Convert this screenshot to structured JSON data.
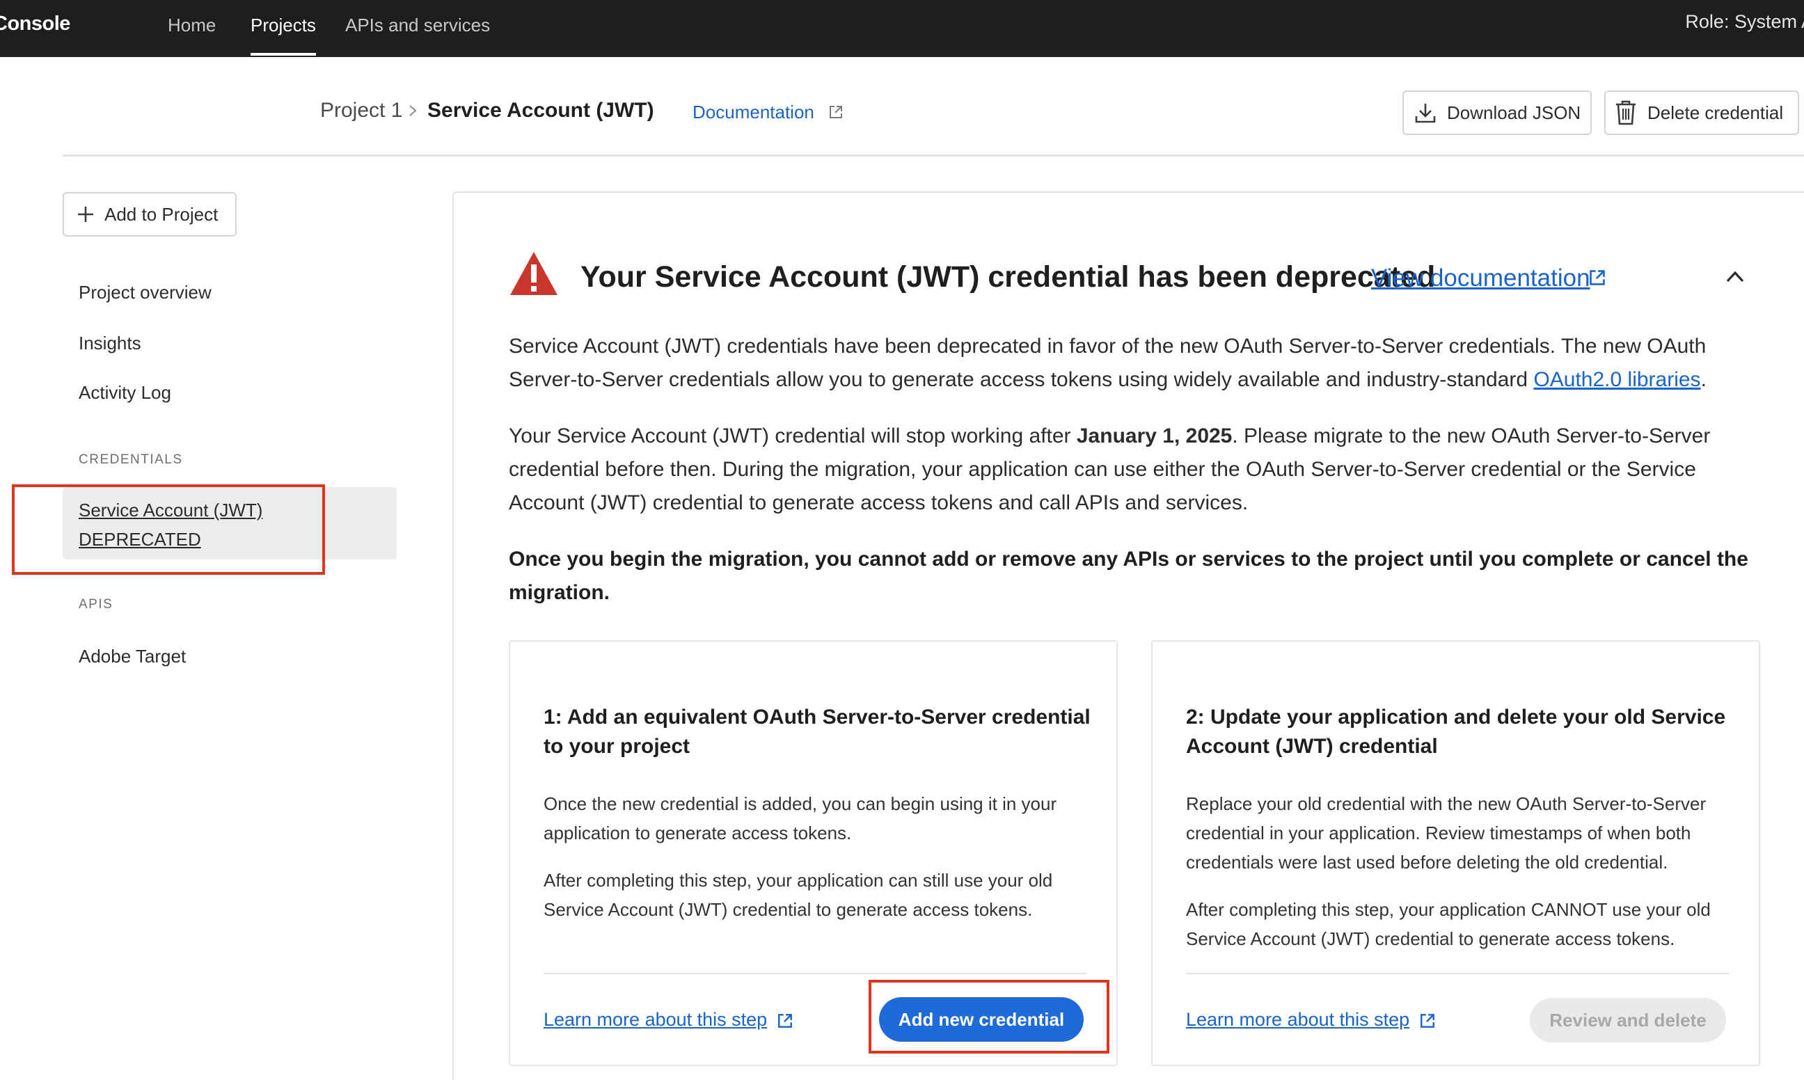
{
  "topbar": {
    "brand": "Console",
    "nav": [
      {
        "label": "Home"
      },
      {
        "label": "Projects"
      },
      {
        "label": "APIs and services"
      }
    ],
    "role": "Role: System A"
  },
  "header": {
    "breadcrumb_project": "Project 1",
    "breadcrumb_current": "Service Account (JWT)",
    "documentation_link": "Documentation",
    "download_json_label": "Download JSON",
    "delete_credential_label": "Delete credential"
  },
  "sidebar": {
    "add_to_project_label": "Add to Project",
    "items": [
      {
        "label": "Project overview"
      },
      {
        "label": "Insights"
      },
      {
        "label": "Activity Log"
      }
    ],
    "credentials_heading": "CREDENTIALS",
    "selected_credential": {
      "line1": "Service Account (JWT)",
      "line2": "DEPRECATED"
    },
    "apis_heading": "APIS",
    "api_items": [
      {
        "label": "Adobe Target"
      }
    ]
  },
  "banner": {
    "title": "Your Service Account (JWT) credential has been deprecated",
    "view_documentation": "View documentation",
    "para1_text": "Service Account (JWT) credentials have been deprecated in favor of the new OAuth Server-to-Server credentials. The new OAuth Server-to-Server credentials allow you to generate access tokens using widely available and industry-standard ",
    "para1_link": "OAuth2.0 libraries",
    "para1_end": ".",
    "para2_before": "Your Service Account (JWT) credential will stop working after ",
    "para2_date": "January 1, 2025",
    "para2_after": ". Please migrate to the new OAuth Server-to-Server credential before then. During the migration, your application can use either the OAuth Server-to-Server credential or the Service Account (JWT) credential to generate access tokens and call APIs and services.",
    "para3": "Once you begin the migration, you cannot add or remove any APIs or services to the project until you complete or cancel the migration."
  },
  "steps": [
    {
      "title": "1: Add an equivalent OAuth Server-to-Server credential to your project",
      "text1": "Once the new credential is added, you can begin using it in your application to generate access tokens.",
      "text2": "After completing this step, your application can still use your old Service Account (JWT) credential to generate access tokens.",
      "learn_more": "Learn more about this step",
      "action": "Add new credential"
    },
    {
      "title": "2: Update your application and delete your old Service Account (JWT) credential",
      "text1": "Replace your old credential with the new OAuth Server-to-Server credential in your application. Review timestamps of when both credentials were last used before deleting the old credential.",
      "text2": "After completing this step, your application CANNOT use your old Service Account (JWT) credential to generate access tokens.",
      "learn_more": "Learn more about this step",
      "action": "Review and delete"
    }
  ],
  "colors": {
    "topbar": "#1e1e1e",
    "link": "#1a63c7",
    "primary_button": "#1f6ad9",
    "warning": "#c9372c",
    "highlight_box": "#e0351f"
  }
}
